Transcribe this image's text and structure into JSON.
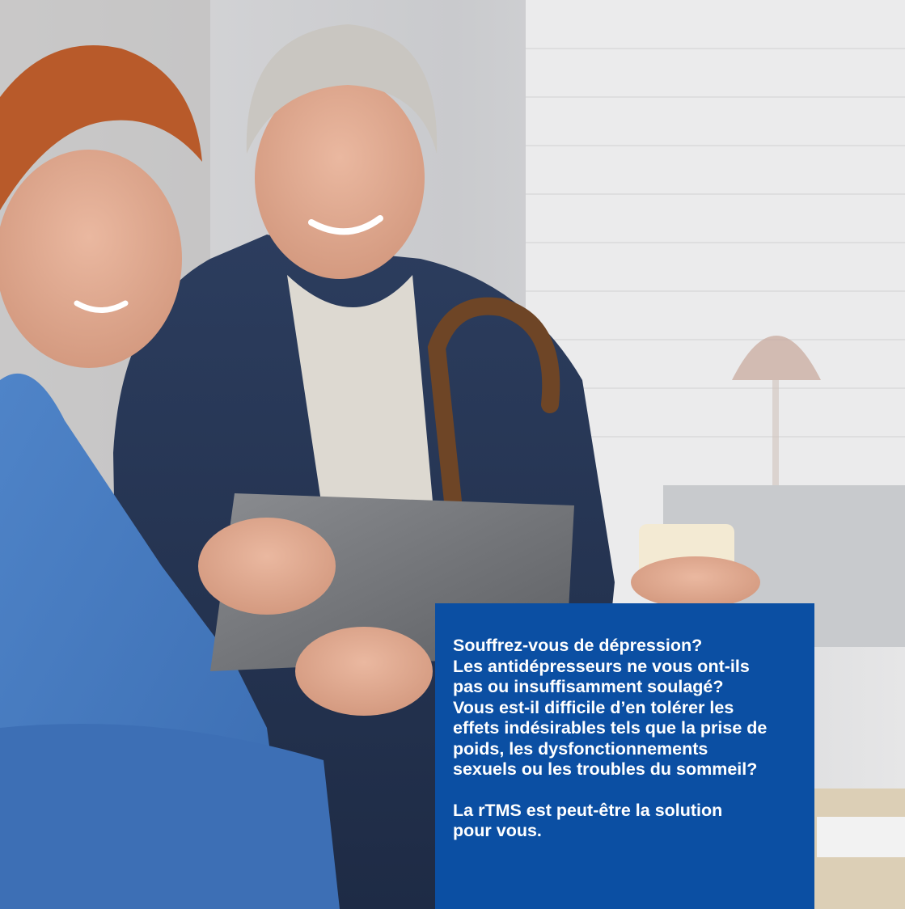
{
  "callout": {
    "question_lines": [
      "Souffrez-vous de dépression?",
      "Les antidépresseurs ne vous ont-ils",
      "pas ou insuffisamment soulagé?",
      "Vous est-il difficile d’en tolérer les",
      "effets indésirables tels que la prise de",
      "poids, les dysfonctionnements",
      "sexuels ou les troubles du sommeil?"
    ],
    "answer_lines": [
      "La rTMS est peut-être la solution",
      "pour vous."
    ],
    "background_color": "#0b4fa3",
    "text_color": "#ffffff"
  },
  "photo": {
    "subject": "healthcare-worker-and-senior-man-with-tablet"
  }
}
